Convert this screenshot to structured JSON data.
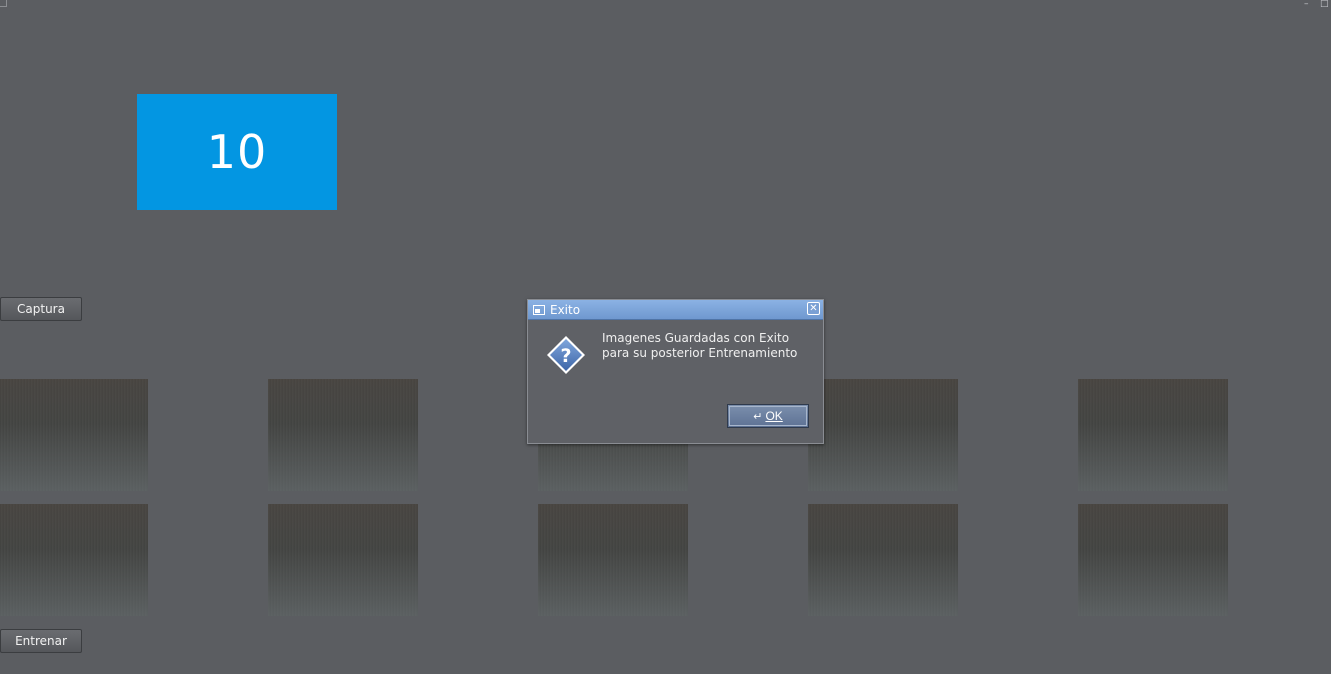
{
  "window": {
    "minimize_glyph": "–",
    "maximize_glyph": "□"
  },
  "counter": {
    "value": "10",
    "color": "#0396e2"
  },
  "buttons": {
    "capture_label": "Captura",
    "train_label": "Entrenar"
  },
  "thumbnails": {
    "rows": 2,
    "columns": 5
  },
  "dialog": {
    "title": "Exito",
    "message": "Imagenes Guardadas con Exito para su posterior Entrenamiento",
    "close_glyph": "✕",
    "ok_label": "OK",
    "ok_icon": "↵",
    "icon": "question-icon",
    "titlebar_color": "#7ea6db"
  }
}
